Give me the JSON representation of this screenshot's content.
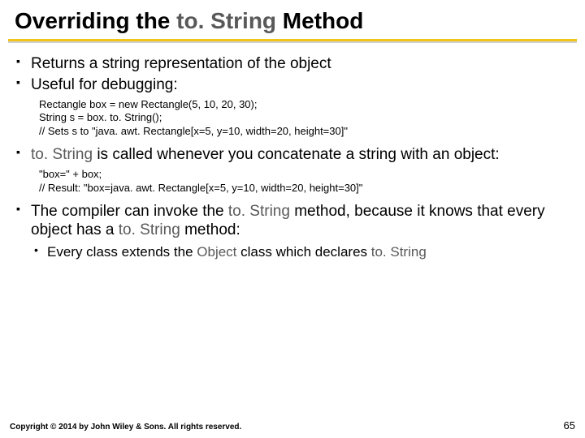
{
  "title_pre": "Overriding the ",
  "title_accent": "to. String",
  "title_post": " Method",
  "bullets": {
    "b1": "Returns a string representation of the object",
    "b2": "Useful for debugging:",
    "code1": "Rectangle box = new Rectangle(5, 10, 20, 30);\nString s = box. to. String();\n// Sets s to \"java. awt. Rectangle[x=5, y=10, width=20, height=30]\"",
    "b3_pre": "",
    "b3_mono": "to. String",
    "b3_post": " is called whenever you concatenate a string with an object:",
    "code2": "\"box=\" + box;\n// Result: \"box=java. awt. Rectangle[x=5, y=10, width=20, height=30]\"",
    "b4_pre": "The compiler can invoke the ",
    "b4_mono": "to. String",
    "b4_mid": " method, because it knows that every object has a ",
    "b4_mono2": "to. String",
    "b4_post": " method:",
    "b5_pre": "Every class extends the ",
    "b5_mono": "Object",
    "b5_mid": " class which declares ",
    "b5_mono2": "to. String"
  },
  "footer": "Copyright © 2014 by John Wiley & Sons. All rights reserved.",
  "page": "65"
}
